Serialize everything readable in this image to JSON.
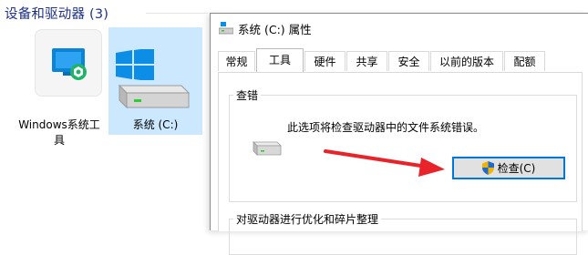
{
  "explorer": {
    "section_header": "设备和驱动器 (3)",
    "tiles": [
      {
        "label": "Windows系统工具"
      },
      {
        "label": "系统 (C:)"
      }
    ]
  },
  "dialog": {
    "title": "系统 (C:) 属性",
    "tabs": [
      "常规",
      "工具",
      "硬件",
      "共享",
      "安全",
      "以前的版本",
      "配额"
    ],
    "active_tab": "工具",
    "error_check": {
      "title": "查错",
      "description": "此选项将检查驱动器中的文件系统错误。",
      "button_label": "检查(C)"
    },
    "optimize": {
      "title": "对驱动器进行优化和碎片整理"
    }
  },
  "colors": {
    "accent": "#0078d7",
    "selection": "#cce8ff",
    "arrow": "#e8232a",
    "header_text": "#1e3287"
  }
}
